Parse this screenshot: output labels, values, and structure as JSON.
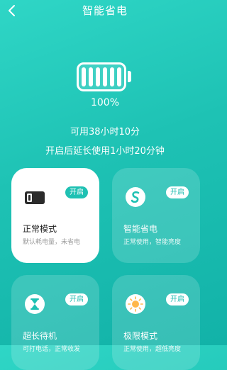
{
  "header": {
    "title": "智能省电",
    "back_icon": "chevron-left-icon"
  },
  "battery": {
    "percent_label": "100%",
    "level_fraction": 1.0,
    "icon": "battery-icon"
  },
  "status": {
    "remaining": "可用38小时10分",
    "extend": "开启后延长使用1小时20分钟"
  },
  "colors": {
    "background": "#1ec2b4",
    "accent": "#1fc1b3",
    "card_active": "#ffffff"
  },
  "modes": [
    {
      "name": "正常模式",
      "desc": "默认耗电量，未省电",
      "badge": "开启",
      "icon": "phone-battery-icon",
      "active": true
    },
    {
      "name": "智能省电",
      "desc": "正常使用，智能亮度",
      "badge": "开启",
      "icon": "smart-s-icon",
      "active": false
    },
    {
      "name": "超长待机",
      "desc": "可打电话，正常收发",
      "badge": "开启",
      "icon": "hourglass-icon",
      "active": false
    },
    {
      "name": "极限模式",
      "desc": "正常使用，超低亮度",
      "badge": "开启",
      "icon": "sun-icon",
      "active": false
    }
  ]
}
